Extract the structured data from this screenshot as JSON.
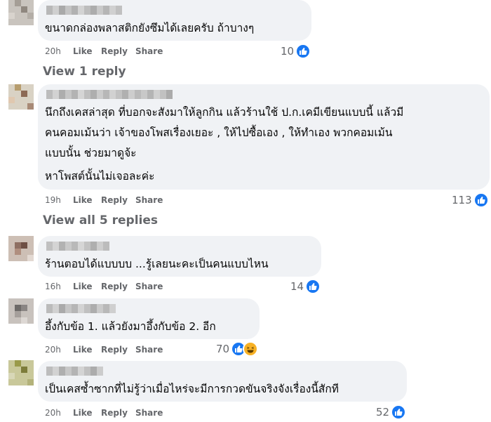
{
  "comments": [
    {
      "lines": [
        "ขนาดกล่องพลาสติกยังซึมได้เลยครับ ถ้าบางๆ"
      ],
      "time": "20h",
      "like": "Like",
      "reply": "Reply",
      "share": "Share",
      "reaction_count": "10",
      "reactions": [
        "like-icon"
      ]
    },
    {
      "lines": [
        "นึกถึงเคสล่าสุด ที่บอกจะสังมาให้ลูกกิน แล้วร้านใช้ ป.ก.เคมีเขียนแบบนี้ แล้วมี",
        "คนคอมเม้นว่า เจ้าของโพสเรื่องเยอะ , ให้ไปซื้อเอง , ให้ทำเอง พวกคอมเม้น",
        "แบบนั้น ช่วยมาดูจ้ะ"
      ],
      "extra_line": "หาโพสต์นั้นไม่เจอละค่ะ",
      "time": "19h",
      "like": "Like",
      "reply": "Reply",
      "share": "Share",
      "reaction_count": "113",
      "reactions": [
        "like-icon"
      ]
    },
    {
      "lines": [
        "ร้านตอบได้แบบบบ ...รู้เลยนะคะเป็นคนแบบไหน"
      ],
      "time": "16h",
      "like": "Like",
      "reply": "Reply",
      "share": "Share",
      "reaction_count": "14",
      "reactions": [
        "like-icon"
      ]
    },
    {
      "lines": [
        "อึ้งกับข้อ 1. แล้วยังมาอึ้งกับข้อ 2. อีก"
      ],
      "time": "20h",
      "like": "Like",
      "reply": "Reply",
      "share": "Share",
      "reaction_count": "70",
      "reactions": [
        "like-icon",
        "haha-icon"
      ]
    },
    {
      "lines": [
        "เป็นเคสซ้ำซากที่ไม่รู้ว่าเมื่อไหร่จะมีการกวดขันจริงจังเรื่องนี้สักที"
      ],
      "time": "20h",
      "like": "Like",
      "reply": "Reply",
      "share": "Share",
      "reaction_count": "52",
      "reactions": [
        "like-icon"
      ]
    }
  ],
  "view_replies": [
    "View 1 reply",
    "View all 5 replies"
  ],
  "colors": {
    "bubble": "#f0f2f5",
    "meta_text": "#65676b",
    "like_blue": "#1877f2",
    "haha_yellow": "#f7b125"
  }
}
